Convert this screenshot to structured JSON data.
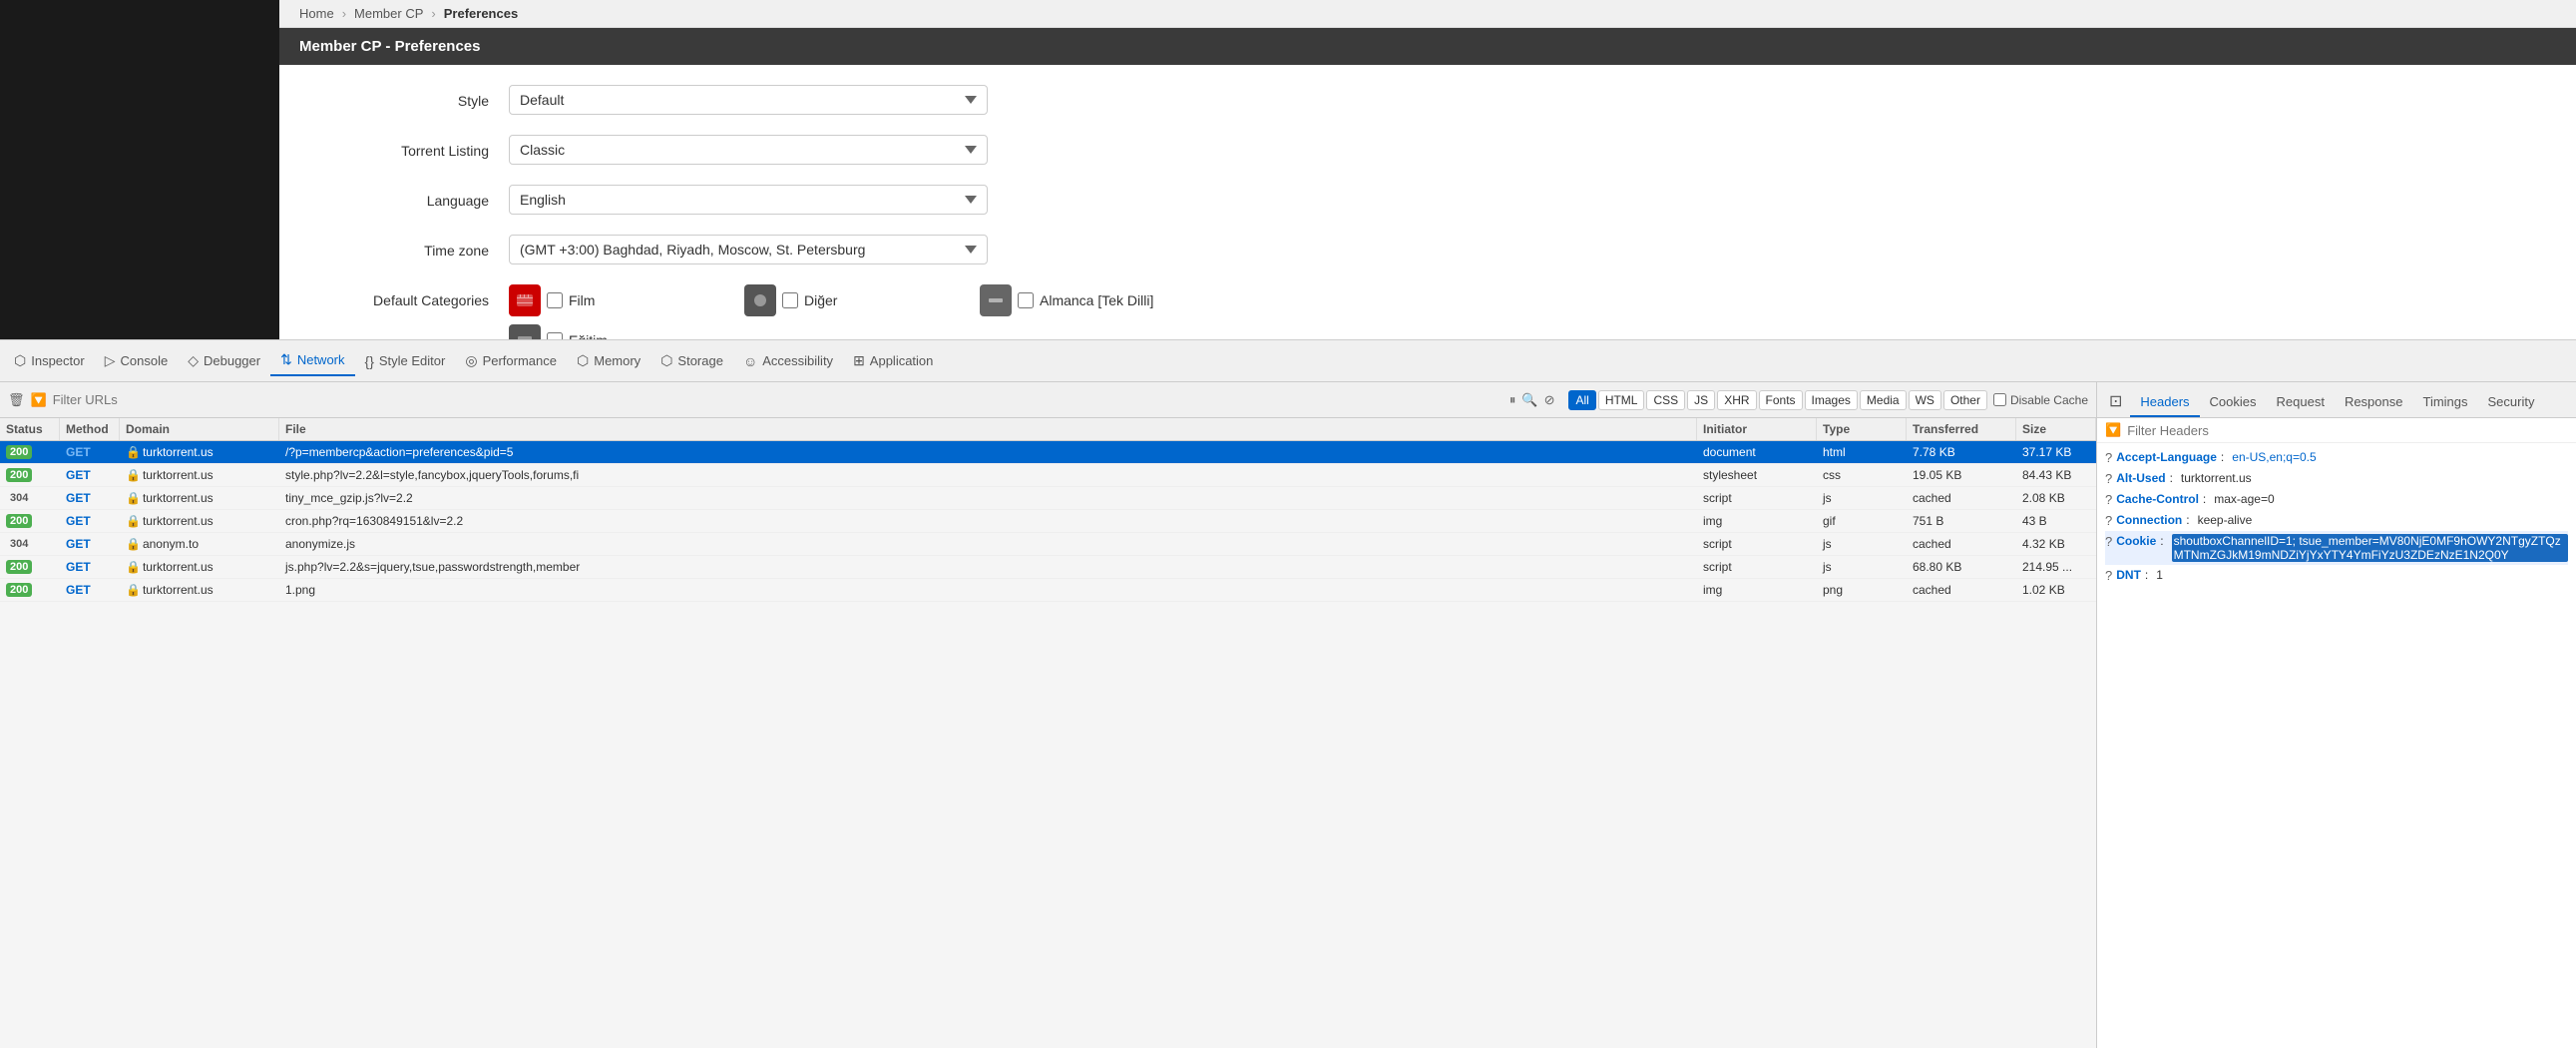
{
  "breadcrumb": {
    "items": [
      "Home",
      "Member CP",
      "Preferences"
    ]
  },
  "page": {
    "title": "Member CP - Preferences"
  },
  "preferences": {
    "style_label": "Style",
    "style_value": "Default",
    "torrent_listing_label": "Torrent Listing",
    "torrent_listing_value": "Classic",
    "language_label": "Language",
    "language_value": "English",
    "timezone_label": "Time zone",
    "timezone_value": "(GMT +3:00) Baghdad, Riyadh, Moscow, St. Petersburg",
    "default_categories_label": "Default Categories",
    "categories": [
      {
        "name": "Film",
        "icon_color": "#c00"
      },
      {
        "name": "Diğer",
        "icon_color": "#555"
      },
      {
        "name": "Almanca [Tek Dilli]",
        "icon_color": "#999"
      },
      {
        "name": "Eğitim",
        "icon_color": "#888"
      }
    ]
  },
  "devtools": {
    "tools": [
      {
        "id": "inspector",
        "label": "Inspector",
        "icon": "⬡"
      },
      {
        "id": "console",
        "label": "Console",
        "icon": "▷"
      },
      {
        "id": "debugger",
        "label": "Debugger",
        "icon": "◇"
      },
      {
        "id": "network",
        "label": "Network",
        "icon": "⇅",
        "active": true
      },
      {
        "id": "style-editor",
        "label": "Style Editor",
        "icon": "{}"
      },
      {
        "id": "performance",
        "label": "Performance",
        "icon": "◎"
      },
      {
        "id": "memory",
        "label": "Memory",
        "icon": "⬡"
      },
      {
        "id": "storage",
        "label": "Storage",
        "icon": "⬡"
      },
      {
        "id": "accessibility",
        "label": "Accessibility",
        "icon": "☺"
      },
      {
        "id": "application",
        "label": "Application",
        "icon": "⊞"
      }
    ]
  },
  "network": {
    "filter_placeholder": "Filter URLs",
    "filter_buttons": [
      "All",
      "HTML",
      "CSS",
      "JS",
      "XHR",
      "Fonts",
      "Images",
      "Media",
      "WS",
      "Other"
    ],
    "active_filter": "All",
    "disable_cache_label": "Disable Cache",
    "columns": [
      "Status",
      "Method",
      "Domain",
      "File",
      "Initiator",
      "Type",
      "Transferred",
      "Size"
    ],
    "requests": [
      {
        "status": "200",
        "status_type": "ok",
        "method": "GET",
        "domain": "turktorrent.us",
        "file": "/?p=membercp&action=preferences&pid=5",
        "initiator": "document",
        "type": "html",
        "transferred": "7.78 KB",
        "size": "37.17 KB",
        "selected": true,
        "secure": true
      },
      {
        "status": "200",
        "status_type": "ok",
        "method": "GET",
        "domain": "turktorrent.us",
        "file": "style.php?lv=2.2&l=style,fancybox,jqueryTools,forums,fi",
        "initiator": "stylesheet",
        "type": "css",
        "transferred": "19.05 KB",
        "size": "84.43 KB",
        "selected": false,
        "secure": true
      },
      {
        "status": "304",
        "status_type": "redirect",
        "method": "GET",
        "domain": "turktorrent.us",
        "file": "tiny_mce_gzip.js?lv=2.2",
        "initiator": "script",
        "type": "js",
        "transferred": "cached",
        "size": "2.08 KB",
        "selected": false,
        "secure": true
      },
      {
        "status": "200",
        "status_type": "ok",
        "method": "GET",
        "domain": "turktorrent.us",
        "file": "cron.php?rq=1630849151&lv=2.2",
        "initiator": "img",
        "type": "gif",
        "transferred": "751 B",
        "size": "43 B",
        "selected": false,
        "secure": true
      },
      {
        "status": "304",
        "status_type": "redirect",
        "method": "GET",
        "domain": "anonym.to",
        "file": "anonymize.js",
        "initiator": "script",
        "type": "js",
        "transferred": "cached",
        "size": "4.32 KB",
        "selected": false,
        "secure": true
      },
      {
        "status": "200",
        "status_type": "ok",
        "method": "GET",
        "domain": "turktorrent.us",
        "file": "js.php?lv=2.2&s=jquery,tsue,passwordstrength,member",
        "initiator": "script",
        "type": "js",
        "transferred": "68.80 KB",
        "size": "214.95 ...",
        "selected": false,
        "secure": true
      },
      {
        "status": "200",
        "status_type": "ok",
        "method": "GET",
        "domain": "turktorrent.us",
        "file": "1.png",
        "initiator": "img",
        "type": "png",
        "transferred": "cached",
        "size": "1.02 KB",
        "selected": false,
        "secure": true
      }
    ]
  },
  "details": {
    "tabs": [
      "Headers",
      "Cookies",
      "Request",
      "Response",
      "Timings",
      "Security"
    ],
    "active_tab": "Headers",
    "filter_placeholder": "Filter Headers",
    "headers": [
      {
        "name": "Accept-Language",
        "value": "en-US,en;q=0.5",
        "highlighted": false
      },
      {
        "name": "Alt-Used",
        "value": "turktorrent.us",
        "highlighted": false
      },
      {
        "name": "Cache-Control",
        "value": "max-age=0",
        "highlighted": false
      },
      {
        "name": "Connection",
        "value": "keep-alive",
        "highlighted": false
      },
      {
        "name": "Cookie",
        "value": "shoutboxChannelID=1; tsue_member=MV80NjE0MF9hOWY2NTgyZTQzMTNmZGJkM19mNDZiYjYxYTY4YmFiYzU3ZDEzNzE1N2Q0Y",
        "highlighted": true
      },
      {
        "name": "DNT",
        "value": "1",
        "highlighted": false
      }
    ]
  }
}
